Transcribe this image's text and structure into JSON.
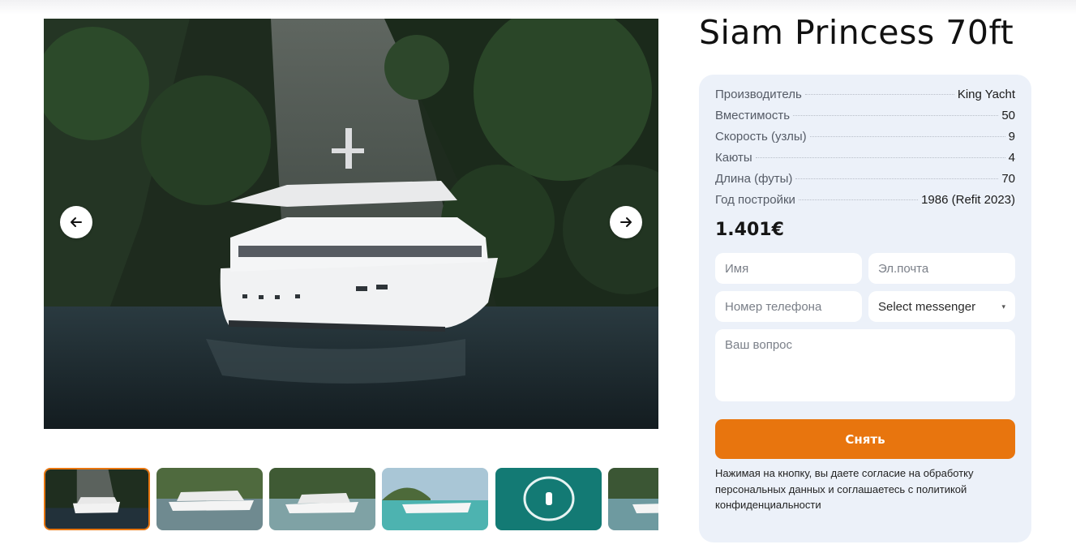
{
  "yacht": {
    "title": "Siam Princess 70ft",
    "price": "1.401€"
  },
  "specs": [
    {
      "label": "Производитель",
      "value": "King Yacht"
    },
    {
      "label": "Вместимость",
      "value": "50"
    },
    {
      "label": "Скорость (узлы)",
      "value": "9"
    },
    {
      "label": "Каюты",
      "value": "4"
    },
    {
      "label": "Длина (футы)",
      "value": "70"
    },
    {
      "label": "Год постройки",
      "value": "1986 (Refit 2023)"
    }
  ],
  "form": {
    "name_placeholder": "Имя",
    "email_placeholder": "Эл.почта",
    "phone_placeholder": "Номер телефона",
    "messenger_selected": "Select messenger",
    "question_placeholder": "Ваш вопрос",
    "submit_label": "Снять",
    "consent_text": "Нажимая на кнопку, вы даете согласие на обработку персональных данных и соглашаетесь с политикой конфиденциальности"
  },
  "gallery": {
    "prev_icon": "arrow-left-icon",
    "next_icon": "arrow-right-icon",
    "active_index": 0
  },
  "colors": {
    "accent": "#e8750e",
    "card_bg": "#ecf1f9"
  }
}
